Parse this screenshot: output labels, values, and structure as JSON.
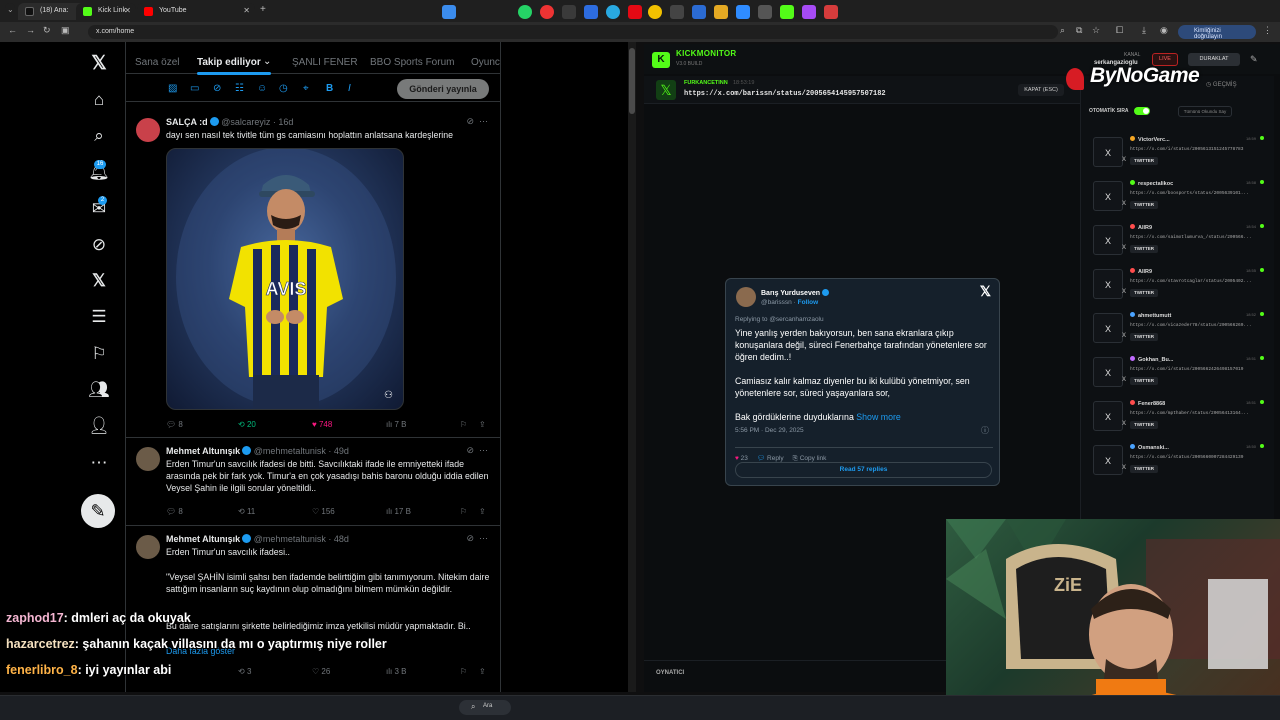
{
  "browser": {
    "tabs": [
      {
        "label": "(18) Ana:",
        "color": "#111111"
      },
      {
        "label": "Kick Link",
        "color": "#53fc18"
      },
      {
        "label": "YouTube",
        "color": "#ff0000"
      }
    ],
    "new_tab": "+",
    "url": "x.com/home",
    "verify_label": "Kimliğinizi doğrulayın"
  },
  "x": {
    "tabs": [
      "Sana özel",
      "Takip ediliyor",
      "ŞANLI FENER",
      "BBO Sports Forum",
      "Oyunc"
    ],
    "active_tab": "Takip ediliyor",
    "notif_badge": "16",
    "msg_badge": "2",
    "post_button": "Gönderi yayınla",
    "tweets": [
      {
        "name": "SALÇA :d",
        "handle": "@salcareyiz · 16d",
        "text": "dayı sen nasıl tek tivitle tüm gs camiasını hoplattın anlatsana kardeşlerine",
        "replies": "8",
        "retweets": "20",
        "likes": "748",
        "views": "7 B"
      },
      {
        "name": "Mehmet Altunışık",
        "handle": "@mehmetaltunisk · 49d",
        "text": "Erden Timur'un savcılık ifadesi de bitti. Savcılıktaki ifade ile emniyetteki ifade arasında pek bir fark yok. Timur'a en çok yasadışı bahis baronu olduğu iddia edilen Veysel Şahin ile ilgili sorular yöneltildi..",
        "replies": "8",
        "retweets": "11",
        "likes": "156",
        "views": "17 B"
      },
      {
        "name": "Mehmet Altunışık",
        "handle": "@mehmetaltunisk · 48d",
        "text": "Erden Timur'un savcılık ifadesi..",
        "text2": "\"Veysel ŞAHİN isimli şahsı ben ifademde belirttiğim gibi tanımıyorum. Nitekim daire sattığım insanların suç kaydının olup olmadığını bilmem mümkün değildir.",
        "text3": "Bu daire satışlarını şirkette belirlediğimiz imza yetkilisi müdür yapmaktadır. Bi..",
        "show_more": "Daha fazla göster",
        "replies": "3",
        "retweets": "",
        "likes": "26",
        "views": "3 B"
      }
    ]
  },
  "chat": [
    {
      "user": "zaphod17",
      "message": ": dmleri aç da okuyak"
    },
    {
      "user": "hazarcetrez",
      "message": ": şahanın kaçak villasını da mı o yaptırmış niye roller"
    },
    {
      "user": "fenerlibro_8",
      "message": ": iyi yayınlar abi"
    }
  ],
  "kick": {
    "title": "KICKMONITOR",
    "version": "V3.0 BUILD",
    "kanal_label": "KANAL",
    "kanal_name": "serkangazioglu",
    "live_label": "LIVE",
    "pause_label": "DURAKLAT",
    "history_label": "GEÇMİŞ",
    "current_user": "FURKANCETINN",
    "current_time": "18:53:19",
    "current_url": "https://x.com/barissn/status/2005654145957507182",
    "close_label": "KAPAT (ESC)",
    "player_label": "OYNATICI",
    "auto_label": "OTOMATİK SIRA",
    "mark_all_label": "Tümünü Okundu Say",
    "queue": [
      {
        "name": "VictorVerc...",
        "url": "https://x.com/i/status/2005613151245778783",
        "tag": "TWITTER",
        "time": "18:59",
        "color": "#f5a623"
      },
      {
        "name": "respectalikoc",
        "url": "https://x.com/boosports/status/2005639101...",
        "tag": "TWITTER",
        "time": "18:58",
        "color": "#53fc18"
      },
      {
        "name": "AllR9",
        "url": "https://x.com/saimotlumurva_/status/200566...",
        "tag": "TWITTER",
        "time": "18:54",
        "color": "#ff4d4d"
      },
      {
        "name": "AllR9",
        "url": "https://x.com/stavrotcaglar/status/2005402...",
        "tag": "TWITTER",
        "time": "18:55",
        "color": "#ff4d4d"
      },
      {
        "name": "ahmettumutt",
        "url": "https://x.com/vicazeder78/status/200566269...",
        "tag": "TWITTER",
        "time": "18:52",
        "color": "#4aa3ff"
      },
      {
        "name": "Gokhan_Bu...",
        "url": "https://x.com/i/status/2005662426498157019",
        "tag": "TWITTER",
        "time": "18:51",
        "color": "#c06bff"
      },
      {
        "name": "Fener8868",
        "url": "https://x.com/mpthaber/status/20056413164...",
        "tag": "TWITTER",
        "time": "18:51",
        "color": "#ff4d4d"
      },
      {
        "name": "Osmanski...",
        "url": "https://x.com/i/status/2005660007284429139",
        "tag": "TWITTER",
        "time": "18:50",
        "color": "#4aa3ff"
      }
    ]
  },
  "card": {
    "name": "Barış Yurduseven",
    "handle": "@barisssn",
    "follow": "Follow",
    "reply_to": "Replying to @sercanhamzaolu",
    "body1": "Yine yanlış yerden bakıyorsun, ben sana ekranlara çıkıp konuşanlara değil, süreci Fenerbahçe tarafından yönetenlere sor öğren dedim..!",
    "body2": "Camiasız kalır kalmaz diyenler bu iki kulübü yönetmiyor, sen yönetenlere sor, süreci yaşayanlara sor,",
    "body3": "Bak gördüklerine duyduklarına",
    "show_more": "Show more",
    "time": "5:56 PM · Dec 29, 2025",
    "likes": "23",
    "reply": "Reply",
    "copy": "Copy link",
    "read_replies": "Read 57 replies"
  },
  "overlay": {
    "brand": "ByNoGame"
  },
  "taskbar": {
    "search": "Ara"
  }
}
